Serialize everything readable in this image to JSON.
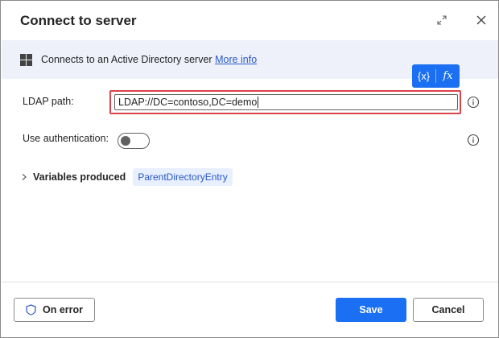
{
  "dialog": {
    "title": "Connect to server"
  },
  "info": {
    "text": "Connects to an Active Directory server",
    "link": "More info"
  },
  "variable_buttons": {
    "variables_label": "{x}",
    "function_label": "fx"
  },
  "ldap": {
    "label": "LDAP path:",
    "value": "LDAP://DC=contoso,DC=demo"
  },
  "authentication": {
    "label": "Use authentication:",
    "enabled": false
  },
  "variables_produced": {
    "label": "Variables produced",
    "chip": "ParentDirectoryEntry"
  },
  "footer": {
    "on_error": "On error",
    "save": "Save",
    "cancel": "Cancel"
  },
  "colors": {
    "accent": "#1a6ff2",
    "highlight_border": "#d9444a",
    "info_band": "#eef1f9",
    "link": "#2a58c8"
  }
}
